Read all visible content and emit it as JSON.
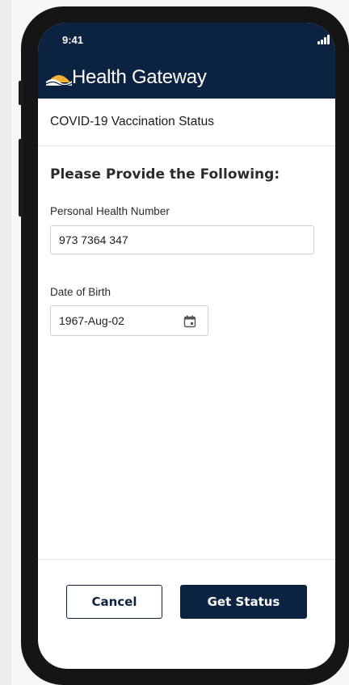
{
  "status_bar": {
    "time": "9:41"
  },
  "app": {
    "title": "Health Gateway"
  },
  "page": {
    "title": "COVID-19 Vaccination Status"
  },
  "form": {
    "heading": "Please Provide the Following:",
    "phn_label": "Personal Health Number",
    "phn_value": "973 7364 347",
    "dob_label": "Date of Birth",
    "dob_value": "1967-Aug-02"
  },
  "buttons": {
    "cancel": "Cancel",
    "submit": "Get Status"
  },
  "colors": {
    "brand_navy": "#0b2240",
    "logo_gold": "#f3b233"
  },
  "icons": [
    "signal-icon",
    "wifi-icon",
    "battery-icon",
    "health-gateway-logo",
    "calendar-icon"
  ]
}
